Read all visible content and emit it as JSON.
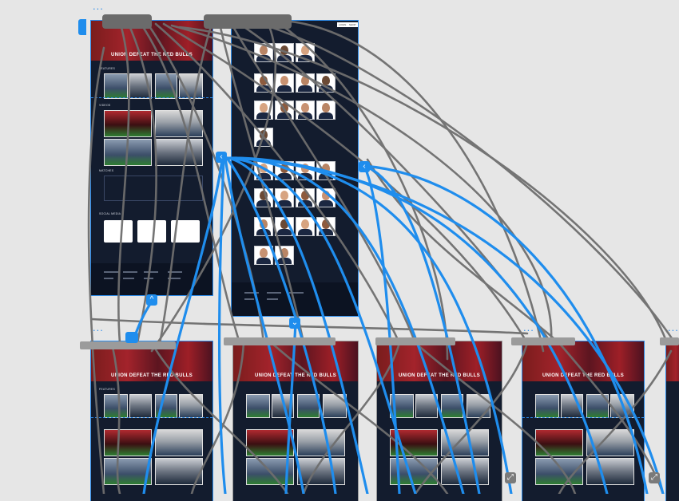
{
  "canvas": {
    "background": "#e6e6e6",
    "accent": "#2d8ceb",
    "wire_gray": "#6e6e6e",
    "artboard_bg": "#131c2e"
  },
  "artboard_menu_glyph": "...",
  "handle_glyphs": {
    "left": "‹",
    "up": "^",
    "down": "⌄",
    "expand": "⤢"
  },
  "main_page": {
    "hero_title": "UNION DEFEAT THE RED BULLS",
    "sections": {
      "features": "FEATURES",
      "videos": "VIDEOS",
      "matches": "MATCHES",
      "social_media": "SOCIAL MEDIA"
    },
    "nav_buttons": [
      "",
      ""
    ]
  },
  "roster_page": {
    "nav_buttons": [
      "LOGIN",
      "SHOP"
    ]
  },
  "bottom_pages": [
    {
      "hero_title": "UNION DEFEAT THE RED BULLS"
    },
    {
      "hero_title": "UNION DEFEAT THE RED BULLS"
    },
    {
      "hero_title": "UNION DEFEAT THE RED BULLS"
    },
    {
      "hero_title": "UNION DEFEAT THE RED BULLS"
    }
  ]
}
